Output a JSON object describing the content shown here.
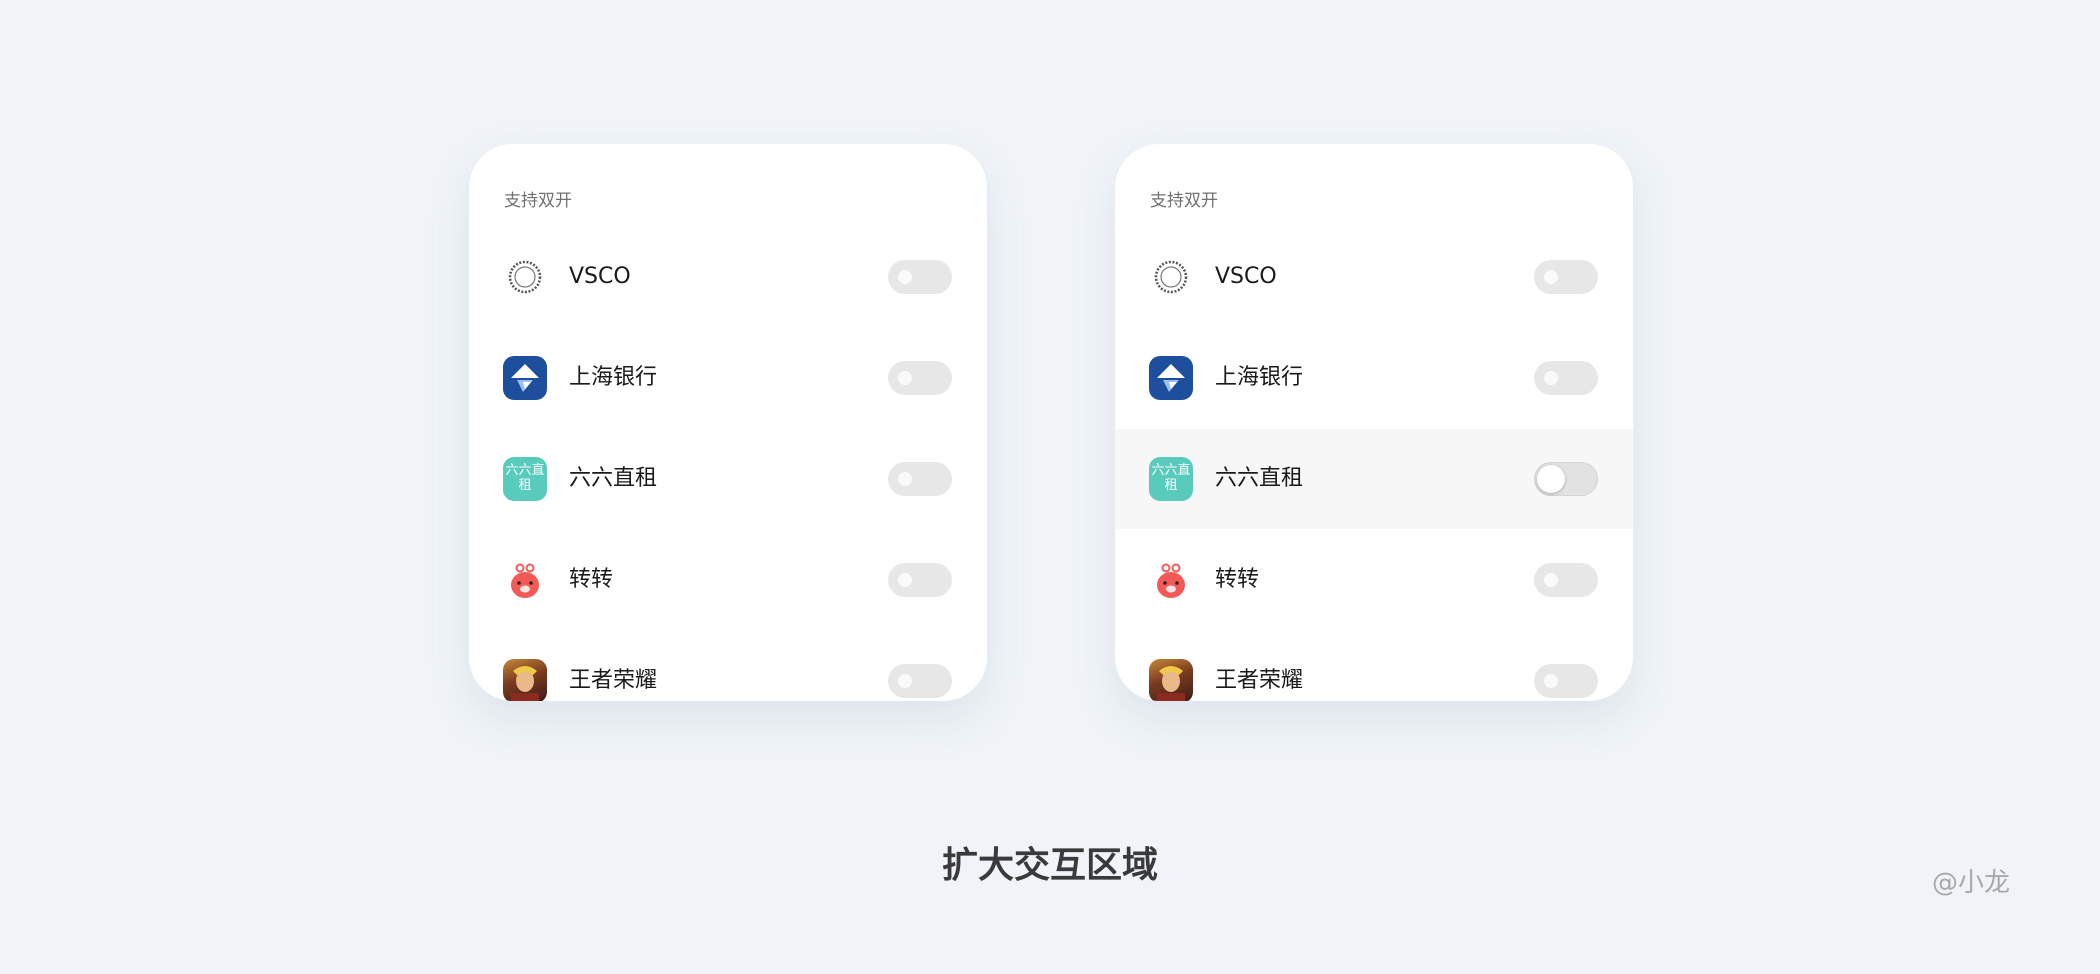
{
  "cards": [
    {
      "section_label": "支持双开",
      "apps": [
        {
          "name": "VSCO",
          "icon": "vsco-icon"
        },
        {
          "name": "上海银行",
          "icon": "bank-of-shanghai-icon"
        },
        {
          "name": "六六直租",
          "icon": "liuliu-zhizu-icon",
          "icon_text": "六六直租"
        },
        {
          "name": "转转",
          "icon": "zhuanzhuan-icon"
        },
        {
          "name": "王者荣耀",
          "icon": "honor-of-kings-icon"
        }
      ]
    },
    {
      "section_label": "支持双开",
      "highlighted_row": 2,
      "apps": [
        {
          "name": "VSCO",
          "icon": "vsco-icon"
        },
        {
          "name": "上海银行",
          "icon": "bank-of-shanghai-icon"
        },
        {
          "name": "六六直租",
          "icon": "liuliu-zhizu-icon",
          "icon_text": "六六直租"
        },
        {
          "name": "转转",
          "icon": "zhuanzhuan-icon"
        },
        {
          "name": "王者荣耀",
          "icon": "honor-of-kings-icon"
        }
      ]
    }
  ],
  "caption": "扩大交互区域",
  "watermark": "@小龙",
  "colors": {
    "background": "#f0f4f8",
    "toggle_off": "#e7e7e7",
    "highlight_row": "#f7f7f7",
    "bank_blue": "#1e4f9c",
    "liuliu_teal": "#58cbbd",
    "zhuanzhuan_red": "#f25a57"
  }
}
